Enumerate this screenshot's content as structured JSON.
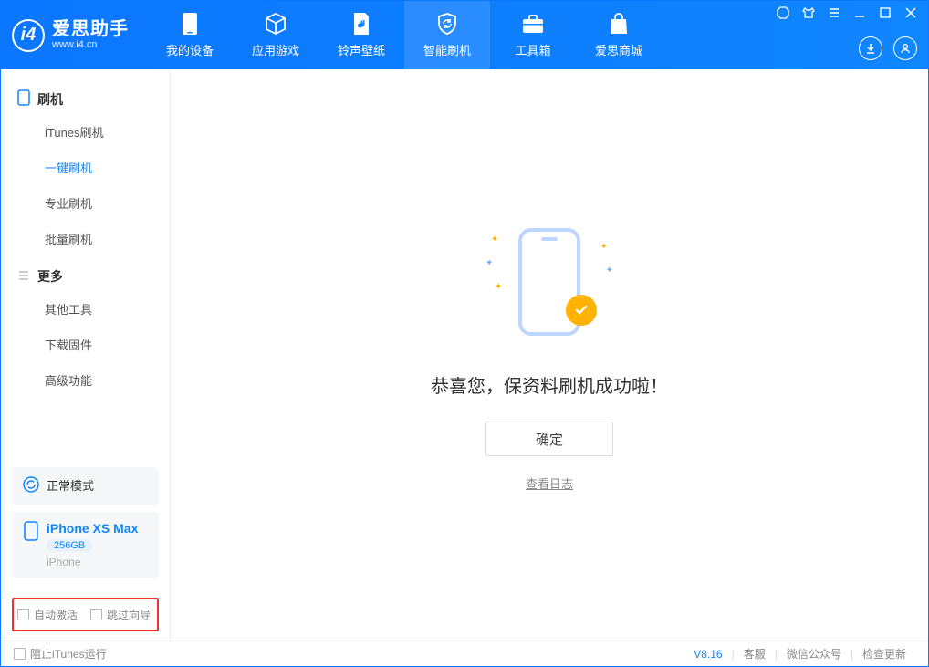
{
  "app": {
    "title": "爱思助手",
    "url": "www.i4.cn"
  },
  "tabs": {
    "device": "我的设备",
    "apps": "应用游戏",
    "ring": "铃声壁纸",
    "flash": "智能刷机",
    "toolbox": "工具箱",
    "store": "爱思商城"
  },
  "sidebar": {
    "group_flash": "刷机",
    "items_flash": {
      "itunes": "iTunes刷机",
      "oneclick": "一键刷机",
      "pro": "专业刷机",
      "batch": "批量刷机"
    },
    "group_more": "更多",
    "items_more": {
      "other": "其他工具",
      "firmware": "下载固件",
      "advanced": "高级功能"
    },
    "mode_card": {
      "label": "正常模式"
    },
    "device_card": {
      "name": "iPhone XS Max",
      "capacity": "256GB",
      "type": "iPhone"
    },
    "bottom": {
      "auto_activate": "自动激活",
      "skip_guide": "跳过向导"
    }
  },
  "main": {
    "success_title": "恭喜您，保资料刷机成功啦！",
    "ok_button": "确定",
    "view_log": "查看日志"
  },
  "status": {
    "block_itunes": "阻止iTunes运行",
    "version": "V8.16",
    "cs": "客服",
    "wechat": "微信公众号",
    "update": "检查更新"
  }
}
